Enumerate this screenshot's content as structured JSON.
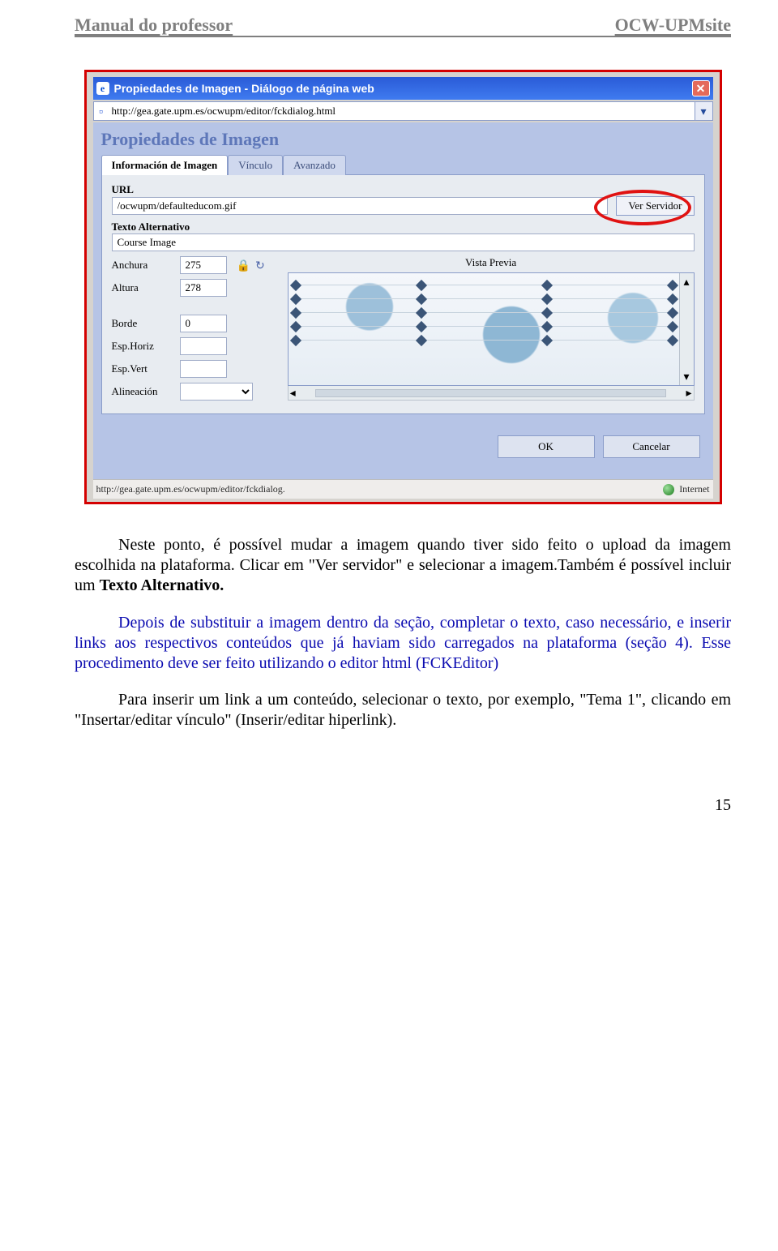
{
  "header": {
    "left": "Manual do professor",
    "right": "OCW-UPMsite"
  },
  "dialog": {
    "title": "Propiedades de Imagen - Diálogo de página web",
    "address": "http://gea.gate.upm.es/ocwupm/editor/fckdialog.html",
    "panel_title": "Propiedades de Imagen",
    "tabs": [
      "Información de Imagen",
      "Vínculo",
      "Avanzado"
    ],
    "labels": {
      "url": "URL",
      "alt": "Texto Alternativo",
      "anchura": "Anchura",
      "altura": "Altura",
      "borde": "Borde",
      "esph": "Esp.Horiz",
      "espv": "Esp.Vert",
      "alin": "Alineación",
      "preview": "Vista Previa"
    },
    "values": {
      "url": "/ocwupm/defaulteducom.gif",
      "alt": "Course Image",
      "anchura": "275",
      "altura": "278",
      "borde": "0",
      "esph": "",
      "espv": "",
      "alin": ""
    },
    "buttons": {
      "server": "Ver Servidor",
      "ok": "OK",
      "cancel": "Cancelar"
    },
    "status": {
      "url": "http://gea.gate.upm.es/ocwupm/editor/fckdialog.",
      "zone": "Internet"
    }
  },
  "body": {
    "p1a": "Neste ponto, é possível mudar a imagem quando tiver sido feito o upload da imagem escolhida na plataforma. Clicar em \"Ver servidor\" e selecionar a imagem.Também é possível incluir um ",
    "p1b": "Texto Alternativo.",
    "p2": "Depois de substituir a imagem dentro da seção, completar o texto, caso necessário, e inserir links aos respectivos conteúdos que já haviam sido carregados na plataforma (seção 4). Esse procedimento deve ser feito utilizando o editor html (FCKEditor)",
    "p3": "Para inserir um link a um conteúdo, selecionar o texto, por exemplo, \"Tema 1\", clicando em \"Insertar/editar vínculo\" (Inserir/editar hiperlink)."
  },
  "page_number": "15"
}
